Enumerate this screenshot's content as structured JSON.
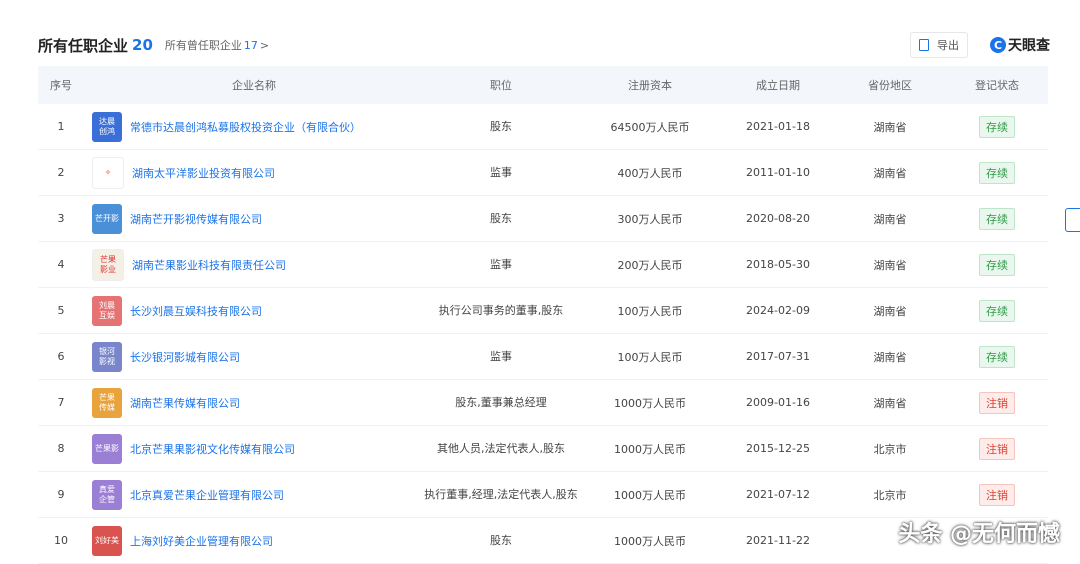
{
  "header": {
    "title": "所有任职企业",
    "count": "20",
    "sub_label": "所有曾任职企业",
    "sub_count": "17",
    "sub_chevron": ">",
    "export_label": "导出",
    "brand_logo": "C",
    "brand_text": "天眼查"
  },
  "columns": {
    "no": "序号",
    "name": "企业名称",
    "position": "职位",
    "capital": "注册资本",
    "date": "成立日期",
    "province": "省份地区",
    "status": "登记状态"
  },
  "rows": [
    {
      "no": "1",
      "logo_text": "达晨\n创鸿",
      "logo_color": "#3b6fd8",
      "name": "常德市达晨创鸿私募股权投资企业（有限合伙）",
      "position": "股东",
      "capital": "64500万人民币",
      "date": "2021-01-18",
      "province": "湖南省",
      "status": "存续",
      "status_type": "ok"
    },
    {
      "no": "2",
      "logo_text": "✧",
      "logo_color": "#ffffff",
      "name": "湖南太平洋影业投资有限公司",
      "position": "监事",
      "capital": "400万人民币",
      "date": "2011-01-10",
      "province": "湖南省",
      "status": "存续",
      "status_type": "ok"
    },
    {
      "no": "3",
      "logo_text": "芒开影",
      "logo_color": "#4a90d9",
      "name": "湖南芒开影视传媒有限公司",
      "position": "股东",
      "capital": "300万人民币",
      "date": "2020-08-20",
      "province": "湖南省",
      "status": "存续",
      "status_type": "ok"
    },
    {
      "no": "4",
      "logo_text": "芒果\n影业",
      "logo_color": "#f5f0e6",
      "name": "湖南芒果影业科技有限责任公司",
      "position": "监事",
      "capital": "200万人民币",
      "date": "2018-05-30",
      "province": "湖南省",
      "status": "存续",
      "status_type": "ok"
    },
    {
      "no": "5",
      "logo_text": "刘晨\n互娱",
      "logo_color": "#e57373",
      "name": "长沙刘晨互娱科技有限公司",
      "position": "执行公司事务的董事,股东",
      "capital": "100万人民币",
      "date": "2024-02-09",
      "province": "湖南省",
      "status": "存续",
      "status_type": "ok"
    },
    {
      "no": "6",
      "logo_text": "银河\n影视",
      "logo_color": "#7986cb",
      "name": "长沙银河影城有限公司",
      "position": "监事",
      "capital": "100万人民币",
      "date": "2017-07-31",
      "province": "湖南省",
      "status": "存续",
      "status_type": "ok"
    },
    {
      "no": "7",
      "logo_text": "芒果\n传媒",
      "logo_color": "#e8a33d",
      "name": "湖南芒果传媒有限公司",
      "position": "股东,董事兼总经理",
      "capital": "1000万人民币",
      "date": "2009-01-16",
      "province": "湖南省",
      "status": "注销",
      "status_type": "bad"
    },
    {
      "no": "8",
      "logo_text": "芒果影",
      "logo_color": "#9b7fd4",
      "name": "北京芒果果影视文化传媒有限公司",
      "position": "其他人员,法定代表人,股东",
      "capital": "1000万人民币",
      "date": "2015-12-25",
      "province": "北京市",
      "status": "注销",
      "status_type": "bad"
    },
    {
      "no": "9",
      "logo_text": "真爱\n企管",
      "logo_color": "#9b7fd4",
      "name": "北京真爱芒果企业管理有限公司",
      "position": "执行董事,经理,法定代表人,股东",
      "capital": "1000万人民币",
      "date": "2021-07-12",
      "province": "北京市",
      "status": "注销",
      "status_type": "bad"
    },
    {
      "no": "10",
      "logo_text": "刘好美",
      "logo_color": "#d9534f",
      "name": "上海刘好美企业管理有限公司",
      "position": "股东",
      "capital": "1000万人民币",
      "date": "2021-11-22",
      "province": "",
      "status": "",
      "status_type": "ok"
    }
  ],
  "watermark": "头条 @无何而憾"
}
